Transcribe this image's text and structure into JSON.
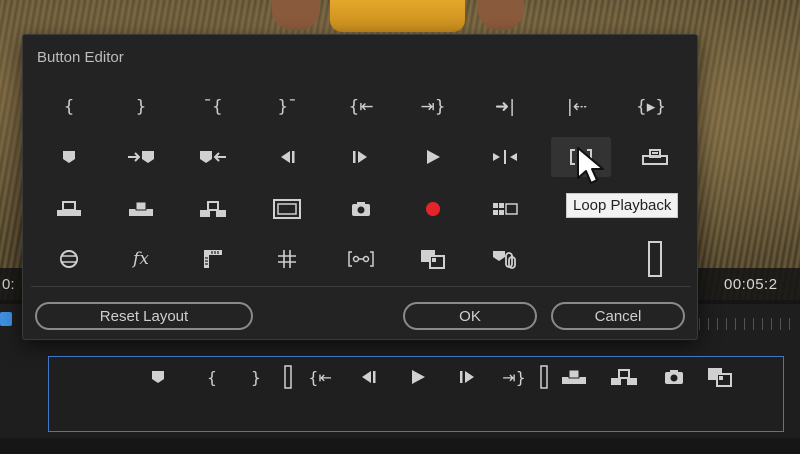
{
  "dialog": {
    "title": "Button Editor",
    "reset_label": "Reset Layout",
    "ok_label": "OK",
    "cancel_label": "Cancel"
  },
  "tooltip": {
    "text": "Loop Playback"
  },
  "timecodes": {
    "left": "0:",
    "right": "00:05:2"
  },
  "icons": {
    "row1": [
      "mark-in-icon",
      "mark-out-icon",
      "clear-in-icon",
      "clear-out-icon",
      "go-to-in-icon",
      "go-to-out-icon",
      "go-to-next-edit-icon",
      "go-to-previous-edit-icon",
      "play-in-to-out-icon"
    ],
    "row2": [
      "add-marker-icon",
      "go-to-next-marker-icon",
      "go-to-previous-marker-icon",
      "step-back-icon",
      "step-forward-icon",
      "play-stop-icon",
      "shuttle-icon",
      "loop-playback-icon",
      "lift-icon"
    ],
    "row3": [
      "insert-icon",
      "overwrite-icon",
      "extract-icon",
      "safe-margins-icon",
      "export-frame-icon",
      "record-icon",
      "multi-camera-icon"
    ],
    "row4": [
      "vr-video-icon",
      "global-fx-mute-icon",
      "show-rulers-icon",
      "show-guides-icon",
      "snap-icon",
      "comparison-view-icon",
      "proxy-toggle-icon",
      "spacer-icon"
    ]
  },
  "colors": {
    "record": "#e3242b",
    "selection_border": "#3f78c8",
    "tooltip_bg": "#f2f2f2"
  }
}
